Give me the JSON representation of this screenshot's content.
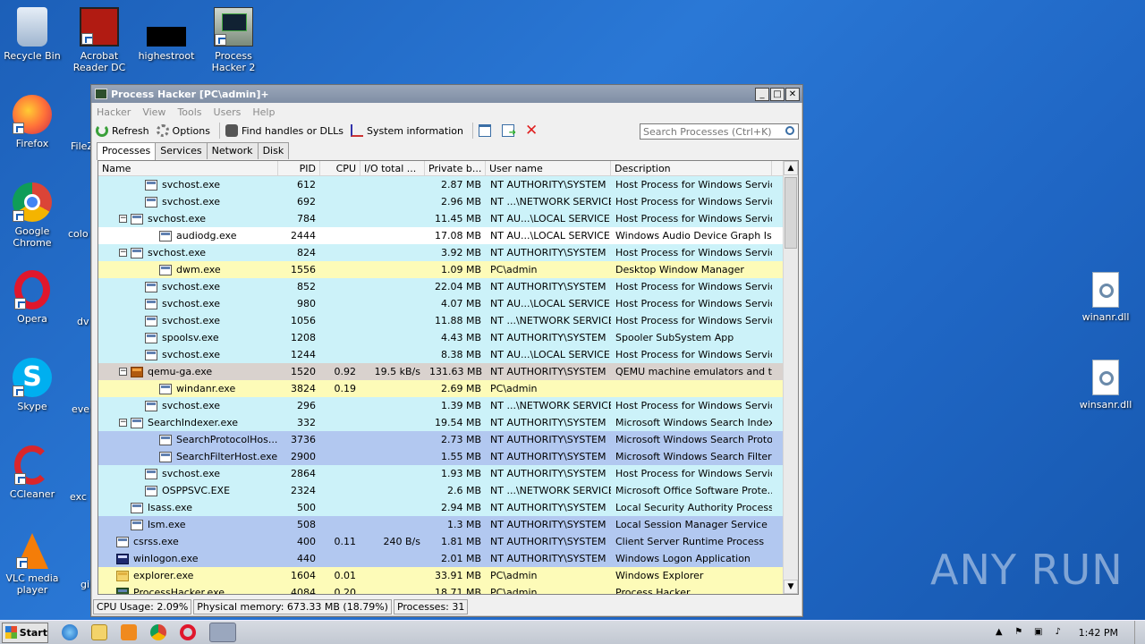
{
  "desktop": {
    "icons": [
      {
        "label": "Recycle Bin",
        "icon": "recycle-bin-icon"
      },
      {
        "label": "Acrobat Reader DC",
        "icon": "acrobat-icon"
      },
      {
        "label": "highestroot",
        "icon": "black-file-icon"
      },
      {
        "label": "Process Hacker 2",
        "icon": "process-hacker-icon"
      },
      {
        "label": "Firefox",
        "icon": "firefox-icon"
      },
      {
        "label": "Google Chrome",
        "icon": "chrome-icon"
      },
      {
        "label": "Opera",
        "icon": "opera-icon"
      },
      {
        "label": "Skype",
        "icon": "skype-icon"
      },
      {
        "label": "CCleaner",
        "icon": "ccleaner-icon"
      },
      {
        "label": "VLC media player",
        "icon": "vlc-icon"
      }
    ],
    "partial_labels": [
      "FileZ",
      "colo",
      "dv",
      "eve",
      "exc",
      "gi"
    ],
    "right_icons": [
      {
        "label": "winanr.dll",
        "icon": "dll-file-icon"
      },
      {
        "label": "winsanr.dll",
        "icon": "dll-file-icon"
      }
    ],
    "watermark": "ANY RUN"
  },
  "window": {
    "title": "Process Hacker [PC\\admin]+",
    "menu": [
      "Hacker",
      "View",
      "Tools",
      "Users",
      "Help"
    ],
    "toolbar": {
      "refresh": "Refresh",
      "options": "Options",
      "find_handles": "Find handles or DLLs",
      "system_info": "System information"
    },
    "search_placeholder": "Search Processes (Ctrl+K)",
    "tabs": [
      "Processes",
      "Services",
      "Network",
      "Disk"
    ],
    "columns": [
      "Name",
      "PID",
      "CPU",
      "I/O total ...",
      "Private b...",
      "User name",
      "Description"
    ],
    "processes": [
      {
        "indent": 3,
        "exp": "",
        "icon": "",
        "name": "svchost.exe",
        "pid": "612",
        "cpu": "",
        "io": "",
        "priv": "2.87 MB",
        "user": "NT AUTHORITY\\SYSTEM",
        "desc": "Host Process for Windows Services",
        "bg": "#ccf2f9"
      },
      {
        "indent": 3,
        "exp": "",
        "icon": "",
        "name": "svchost.exe",
        "pid": "692",
        "cpu": "",
        "io": "",
        "priv": "2.96 MB",
        "user": "NT ...\\NETWORK SERVICE",
        "desc": "Host Process for Windows Services",
        "bg": "#ccf2f9"
      },
      {
        "indent": 2,
        "exp": "−",
        "icon": "",
        "name": "svchost.exe",
        "pid": "784",
        "cpu": "",
        "io": "",
        "priv": "11.45 MB",
        "user": "NT AU...\\LOCAL SERVICE",
        "desc": "Host Process for Windows Services",
        "bg": "#ccf2f9"
      },
      {
        "indent": 4,
        "exp": "",
        "icon": "",
        "name": "audiodg.exe",
        "pid": "2444",
        "cpu": "",
        "io": "",
        "priv": "17.08 MB",
        "user": "NT AU...\\LOCAL SERVICE",
        "desc": "Windows Audio Device Graph Is...",
        "bg": "#ffffff"
      },
      {
        "indent": 2,
        "exp": "−",
        "icon": "",
        "name": "svchost.exe",
        "pid": "824",
        "cpu": "",
        "io": "",
        "priv": "3.92 MB",
        "user": "NT AUTHORITY\\SYSTEM",
        "desc": "Host Process for Windows Services",
        "bg": "#ccf2f9"
      },
      {
        "indent": 4,
        "exp": "",
        "icon": "",
        "name": "dwm.exe",
        "pid": "1556",
        "cpu": "",
        "io": "",
        "priv": "1.09 MB",
        "user": "PC\\admin",
        "desc": "Desktop Window Manager",
        "bg": "#fdfbb8"
      },
      {
        "indent": 3,
        "exp": "",
        "icon": "",
        "name": "svchost.exe",
        "pid": "852",
        "cpu": "",
        "io": "",
        "priv": "22.04 MB",
        "user": "NT AUTHORITY\\SYSTEM",
        "desc": "Host Process for Windows Services",
        "bg": "#ccf2f9"
      },
      {
        "indent": 3,
        "exp": "",
        "icon": "",
        "name": "svchost.exe",
        "pid": "980",
        "cpu": "",
        "io": "",
        "priv": "4.07 MB",
        "user": "NT AU...\\LOCAL SERVICE",
        "desc": "Host Process for Windows Services",
        "bg": "#ccf2f9"
      },
      {
        "indent": 3,
        "exp": "",
        "icon": "",
        "name": "svchost.exe",
        "pid": "1056",
        "cpu": "",
        "io": "",
        "priv": "11.88 MB",
        "user": "NT ...\\NETWORK SERVICE",
        "desc": "Host Process for Windows Services",
        "bg": "#ccf2f9"
      },
      {
        "indent": 3,
        "exp": "",
        "icon": "",
        "name": "spoolsv.exe",
        "pid": "1208",
        "cpu": "",
        "io": "",
        "priv": "4.43 MB",
        "user": "NT AUTHORITY\\SYSTEM",
        "desc": "Spooler SubSystem App",
        "bg": "#ccf2f9"
      },
      {
        "indent": 3,
        "exp": "",
        "icon": "",
        "name": "svchost.exe",
        "pid": "1244",
        "cpu": "",
        "io": "",
        "priv": "8.38 MB",
        "user": "NT AU...\\LOCAL SERVICE",
        "desc": "Host Process for Windows Services",
        "bg": "#ccf2f9"
      },
      {
        "indent": 2,
        "exp": "−",
        "icon": "qemu",
        "name": "qemu-ga.exe",
        "pid": "1520",
        "cpu": "0.92",
        "io": "19.5 kB/s",
        "priv": "131.63 MB",
        "user": "NT AUTHORITY\\SYSTEM",
        "desc": "QEMU machine emulators and tools",
        "bg": "#d9d2ce"
      },
      {
        "indent": 4,
        "exp": "",
        "icon": "",
        "name": "windanr.exe",
        "pid": "3824",
        "cpu": "0.19",
        "io": "",
        "priv": "2.69 MB",
        "user": "PC\\admin",
        "desc": "",
        "bg": "#fdfbb8"
      },
      {
        "indent": 3,
        "exp": "",
        "icon": "",
        "name": "svchost.exe",
        "pid": "296",
        "cpu": "",
        "io": "",
        "priv": "1.39 MB",
        "user": "NT ...\\NETWORK SERVICE",
        "desc": "Host Process for Windows Services",
        "bg": "#ccf2f9"
      },
      {
        "indent": 2,
        "exp": "−",
        "icon": "",
        "name": "SearchIndexer.exe",
        "pid": "332",
        "cpu": "",
        "io": "",
        "priv": "19.54 MB",
        "user": "NT AUTHORITY\\SYSTEM",
        "desc": "Microsoft Windows Search Indexer",
        "bg": "#ccf2f9"
      },
      {
        "indent": 4,
        "exp": "",
        "icon": "",
        "name": "SearchProtocolHos...",
        "pid": "3736",
        "cpu": "",
        "io": "",
        "priv": "2.73 MB",
        "user": "NT AUTHORITY\\SYSTEM",
        "desc": "Microsoft Windows Search Proto...",
        "bg": "#b2c8f0"
      },
      {
        "indent": 4,
        "exp": "",
        "icon": "",
        "name": "SearchFilterHost.exe",
        "pid": "2900",
        "cpu": "",
        "io": "",
        "priv": "1.55 MB",
        "user": "NT AUTHORITY\\SYSTEM",
        "desc": "Microsoft Windows Search Filter ...",
        "bg": "#b2c8f0"
      },
      {
        "indent": 3,
        "exp": "",
        "icon": "",
        "name": "svchost.exe",
        "pid": "2864",
        "cpu": "",
        "io": "",
        "priv": "1.93 MB",
        "user": "NT AUTHORITY\\SYSTEM",
        "desc": "Host Process for Windows Services",
        "bg": "#ccf2f9"
      },
      {
        "indent": 3,
        "exp": "",
        "icon": "",
        "name": "OSPPSVC.EXE",
        "pid": "2324",
        "cpu": "",
        "io": "",
        "priv": "2.6 MB",
        "user": "NT ...\\NETWORK SERVICE",
        "desc": "Microsoft Office Software Prote...",
        "bg": "#ccf2f9"
      },
      {
        "indent": 2,
        "exp": "",
        "icon": "",
        "name": "lsass.exe",
        "pid": "500",
        "cpu": "",
        "io": "",
        "priv": "2.94 MB",
        "user": "NT AUTHORITY\\SYSTEM",
        "desc": "Local Security Authority Process",
        "bg": "#ccf2f9"
      },
      {
        "indent": 2,
        "exp": "",
        "icon": "",
        "name": "lsm.exe",
        "pid": "508",
        "cpu": "",
        "io": "",
        "priv": "1.3 MB",
        "user": "NT AUTHORITY\\SYSTEM",
        "desc": "Local Session Manager Service",
        "bg": "#b2c8f0"
      },
      {
        "indent": 1,
        "exp": "",
        "icon": "",
        "name": "csrss.exe",
        "pid": "400",
        "cpu": "0.11",
        "io": "240 B/s",
        "priv": "1.81 MB",
        "user": "NT AUTHORITY\\SYSTEM",
        "desc": "Client Server Runtime Process",
        "bg": "#b2c8f0"
      },
      {
        "indent": 1,
        "exp": "",
        "icon": "winlogon",
        "name": "winlogon.exe",
        "pid": "440",
        "cpu": "",
        "io": "",
        "priv": "2.01 MB",
        "user": "NT AUTHORITY\\SYSTEM",
        "desc": "Windows Logon Application",
        "bg": "#b2c8f0"
      },
      {
        "indent": 1,
        "exp": "",
        "icon": "folder",
        "name": "explorer.exe",
        "pid": "1604",
        "cpu": "0.01",
        "io": "",
        "priv": "33.91 MB",
        "user": "PC\\admin",
        "desc": "Windows Explorer",
        "bg": "#fdfbb8"
      },
      {
        "indent": 1,
        "exp": "",
        "icon": "ph",
        "name": "ProcessHacker.exe",
        "pid": "4084",
        "cpu": "0.20",
        "io": "",
        "priv": "18.71 MB",
        "user": "PC\\admin",
        "desc": "Process Hacker",
        "bg": "#fdfbb8"
      }
    ],
    "status": {
      "cpu": "CPU Usage: 2.09%",
      "memory": "Physical memory: 673.33 MB (18.79%)",
      "processes": "Processes: 31"
    }
  },
  "taskbar": {
    "start": "Start",
    "clock": "1:42 PM"
  }
}
